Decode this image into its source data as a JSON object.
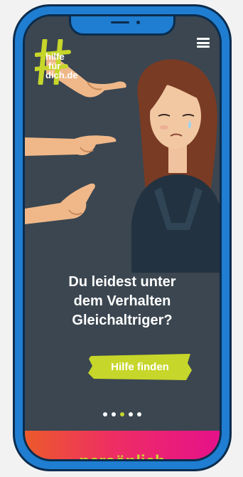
{
  "logo": {
    "lines": [
      "hilfe",
      "für",
      "dich.de"
    ]
  },
  "hero": {
    "headline_lines": [
      "Du leidest unter",
      "dem Verhalten",
      "Gleichaltriger?"
    ],
    "cta_label": "Hilfe finden"
  },
  "carousel": {
    "count": 5,
    "active_index": 2
  },
  "next_section": {
    "title": "persönlich"
  },
  "icons": {
    "menu": "hamburger-menu-icon",
    "logo_mark": "hash-logo-icon"
  },
  "colors": {
    "frame": "#1f7ed1",
    "frame_outline": "#0b2c4e",
    "screen_bg": "#3b4650",
    "accent": "#c6d62a",
    "gradient_start": "#ec5a2b",
    "gradient_end": "#e6118a"
  }
}
